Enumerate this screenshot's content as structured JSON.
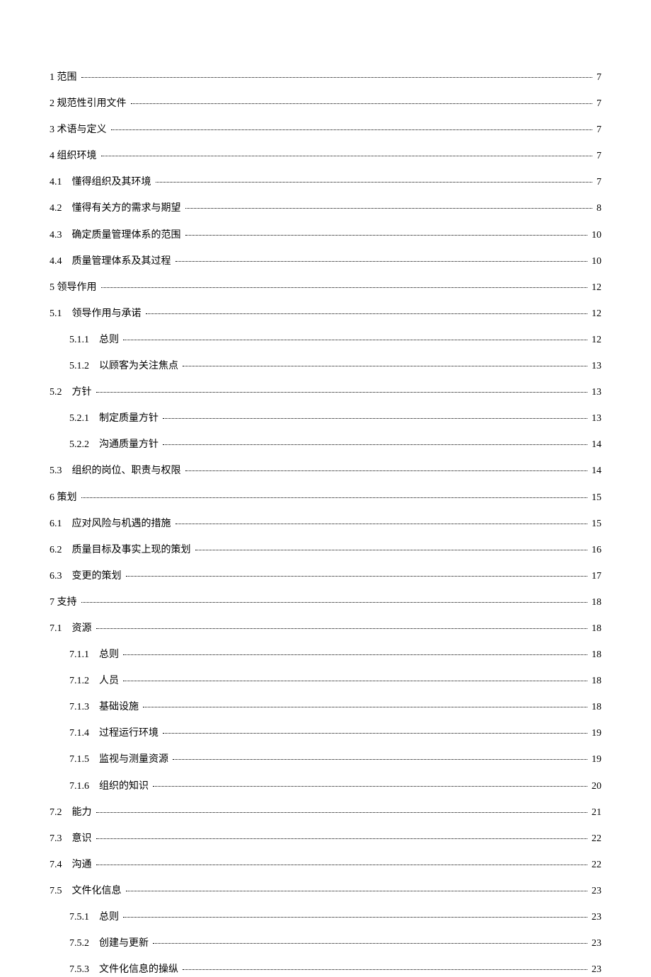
{
  "toc": [
    {
      "level": 0,
      "num": "1",
      "title": "范围",
      "page": "7",
      "numGap": false
    },
    {
      "level": 0,
      "num": "2",
      "title": "规范性引用文件",
      "page": "7",
      "numGap": false
    },
    {
      "level": 0,
      "num": "3",
      "title": "术语与定义",
      "page": "7",
      "numGap": false
    },
    {
      "level": 0,
      "num": "4",
      "title": "组织环境",
      "page": "7",
      "numGap": false
    },
    {
      "level": 1,
      "num": "4.1",
      "title": "懂得组织及其环境",
      "page": "7",
      "numGap": true
    },
    {
      "level": 1,
      "num": "4.2",
      "title": "懂得有关方的需求与期望",
      "page": "8",
      "numGap": true
    },
    {
      "level": 1,
      "num": "4.3",
      "title": "确定质量管理体系的范围",
      "page": "10",
      "numGap": true
    },
    {
      "level": 1,
      "num": "4.4",
      "title": "质量管理体系及其过程",
      "page": "10",
      "numGap": true
    },
    {
      "level": 0,
      "num": "5",
      "title": "领导作用",
      "page": "12",
      "numGap": false
    },
    {
      "level": 1,
      "num": "5.1",
      "title": "领导作用与承诺",
      "page": "12",
      "numGap": true
    },
    {
      "level": 2,
      "num": "5.1.1",
      "title": "总则",
      "page": "12",
      "numGap": true
    },
    {
      "level": 2,
      "num": "5.1.2",
      "title": "以顾客为关注焦点",
      "page": "13",
      "numGap": true
    },
    {
      "level": 1,
      "num": "5.2",
      "title": "方针",
      "page": "13",
      "numGap": true
    },
    {
      "level": 2,
      "num": "5.2.1",
      "title": "制定质量方针",
      "page": "13",
      "numGap": true
    },
    {
      "level": 2,
      "num": "5.2.2",
      "title": "沟通质量方针",
      "page": "14",
      "numGap": true
    },
    {
      "level": 1,
      "num": "5.3",
      "title": "组织的岗位、职责与权限",
      "page": "14",
      "numGap": true
    },
    {
      "level": 0,
      "num": "6",
      "title": "策划",
      "page": "15",
      "numGap": false
    },
    {
      "level": 1,
      "num": "6.1",
      "title": "应对风险与机遇的措施",
      "page": "15",
      "numGap": true
    },
    {
      "level": 1,
      "num": "6.2",
      "title": "质量目标及事实上现的策划",
      "page": "16",
      "numGap": true
    },
    {
      "level": 1,
      "num": "6.3",
      "title": "变更的策划",
      "page": "17",
      "numGap": true
    },
    {
      "level": 0,
      "num": "7",
      "title": "支持",
      "page": "18",
      "numGap": false
    },
    {
      "level": 1,
      "num": "7.1",
      "title": "资源",
      "page": "18",
      "numGap": true
    },
    {
      "level": 2,
      "num": "7.1.1",
      "title": "总则",
      "page": "18",
      "numGap": true
    },
    {
      "level": 2,
      "num": "7.1.2",
      "title": "人员",
      "page": "18",
      "numGap": true
    },
    {
      "level": 2,
      "num": "7.1.3",
      "title": "基础设施",
      "page": "18",
      "numGap": true
    },
    {
      "level": 2,
      "num": "7.1.4",
      "title": "过程运行环境",
      "page": "19",
      "numGap": true
    },
    {
      "level": 2,
      "num": "7.1.5",
      "title": "监视与测量资源",
      "page": "19",
      "numGap": true
    },
    {
      "level": 2,
      "num": "7.1.6",
      "title": "组织的知识",
      "page": "20",
      "numGap": true
    },
    {
      "level": 1,
      "num": "7.2",
      "title": "能力",
      "page": "21",
      "numGap": true
    },
    {
      "level": 1,
      "num": "7.3",
      "title": "意识",
      "page": "22",
      "numGap": true
    },
    {
      "level": 1,
      "num": "7.4",
      "title": "沟通",
      "page": "22",
      "numGap": true
    },
    {
      "level": 1,
      "num": "7.5",
      "title": "文件化信息",
      "page": "23",
      "numGap": true
    },
    {
      "level": 2,
      "num": "7.5.1",
      "title": "总则",
      "page": "23",
      "numGap": true
    },
    {
      "level": 2,
      "num": "7.5.2",
      "title": "创建与更新",
      "page": "23",
      "numGap": true
    },
    {
      "level": 2,
      "num": "7.5.3",
      "title": "文件化信息的操纵",
      "page": "23",
      "numGap": true
    }
  ]
}
